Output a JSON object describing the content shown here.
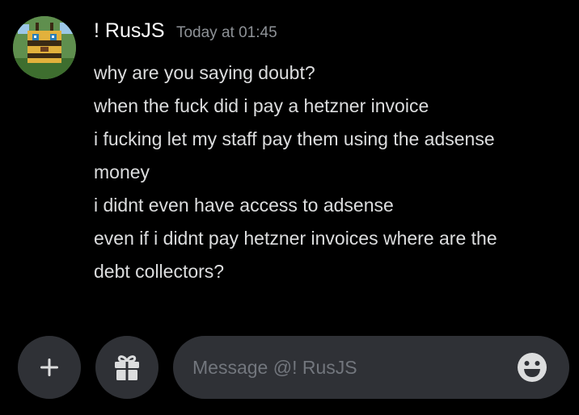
{
  "message": {
    "author": "! RusJS",
    "timestamp": "Today at 01:45",
    "lines": [
      "why are you saying doubt?",
      "when the fuck did i pay a hetzner invoice",
      "i fucking let my staff pay them using the adsense",
      "money",
      "i didnt even have access to adsense",
      "even if i didnt pay hetzner invoices where are the",
      "debt collectors?"
    ],
    "avatar_icon": "pixel-bee-avatar-icon"
  },
  "composer": {
    "placeholder": "Message @! RusJS",
    "value": ""
  },
  "toolbar": {
    "add_icon": "plus-icon",
    "gift_icon": "gift-icon",
    "emoji_icon": "emoji-icon"
  },
  "colors": {
    "background": "#000000",
    "surface": "#2f3136",
    "text": "#dcddde",
    "muted": "#8e9297"
  }
}
